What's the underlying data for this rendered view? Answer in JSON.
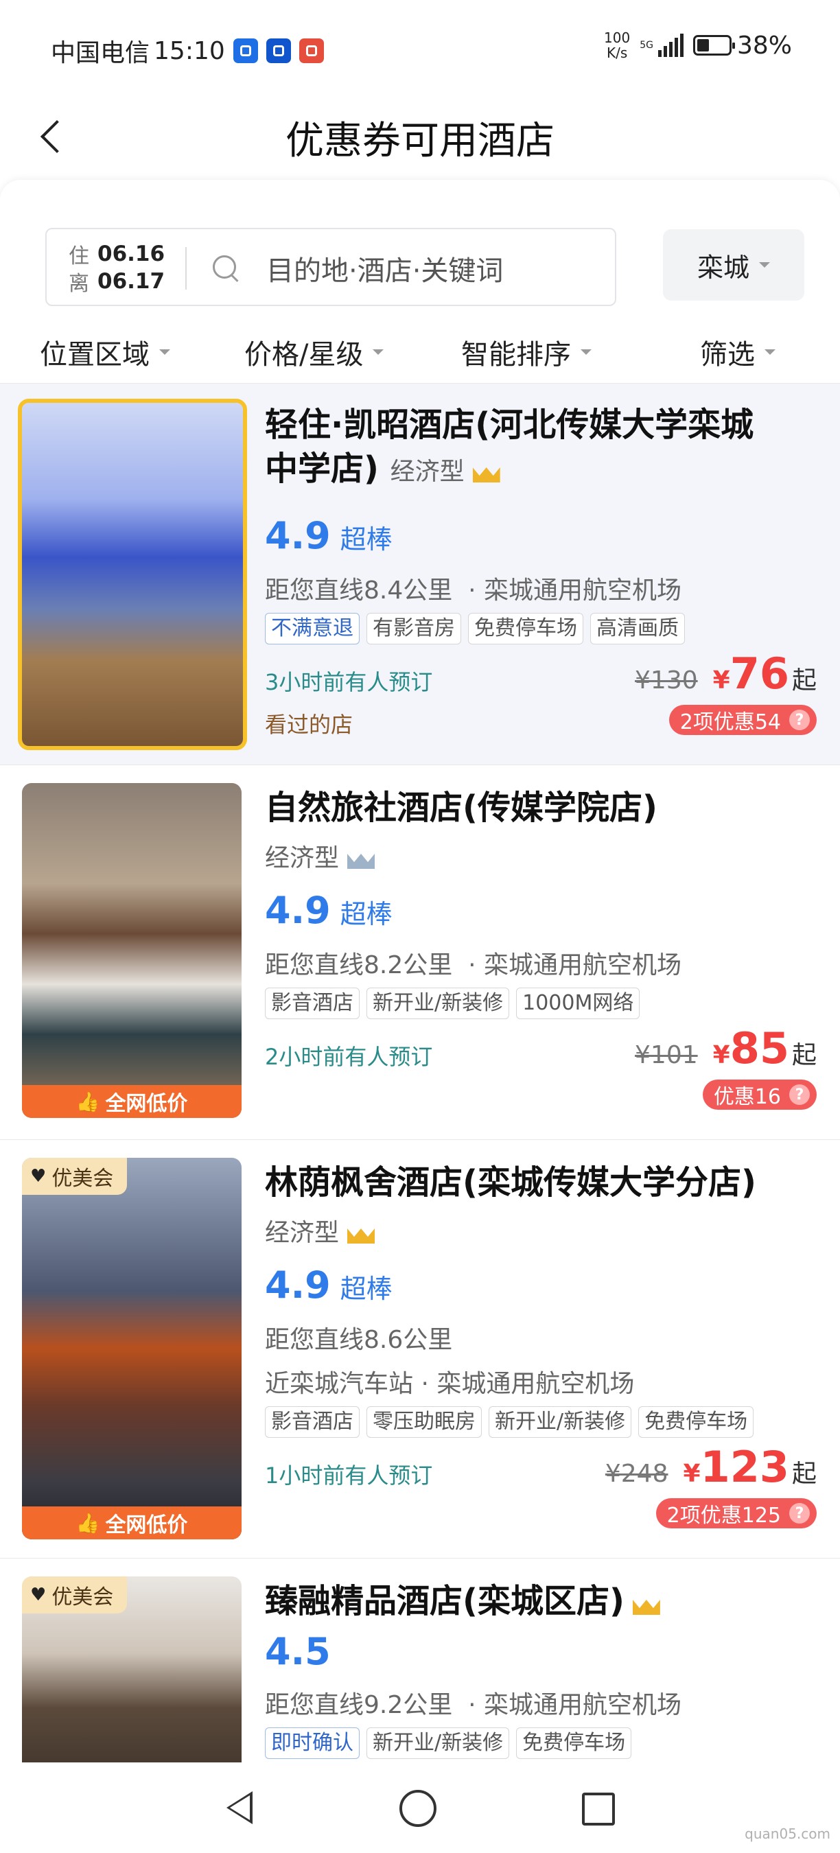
{
  "status_bar": {
    "carrier": "中国电信",
    "time": "15:10",
    "net_speed_value": "100",
    "net_speed_unit": "K/s",
    "network": "5G",
    "battery_percent": "38%",
    "battery_level": 0.38
  },
  "header": {
    "title": "优惠券可用酒店"
  },
  "search": {
    "checkin_label": "住",
    "checkin_date": "06.16",
    "checkout_label": "离",
    "checkout_date": "06.17",
    "placeholder": "目的地·酒店·关键词",
    "city": "栾城"
  },
  "filters": [
    "位置区域",
    "价格/星级",
    "智能排序",
    "筛选"
  ],
  "hotels": [
    {
      "name_line1": "轻住·凯昭酒店(河北传媒大学栾城",
      "name_line2": "中学店)",
      "type": "经济型",
      "score": "4.9",
      "score_word": "超棒",
      "distance": "距您直线8.4公里",
      "landmark": "· 栾城通用航空机场",
      "tags": [
        "不满意退",
        "有影音房",
        "免费停车场",
        "高清画质"
      ],
      "booked": "3小时前有人预订",
      "viewed": "看过的店",
      "orig_price": "¥130",
      "currency": "¥",
      "price": "76",
      "suffix": "起",
      "promo": "2项优惠54",
      "promo_icon": "?"
    },
    {
      "name": "自然旅社酒店(传媒学院店)",
      "type": "经济型",
      "score": "4.9",
      "score_word": "超棒",
      "distance": "距您直线8.2公里",
      "landmark": "· 栾城通用航空机场",
      "tags": [
        "影音酒店",
        "新开业/新装修",
        "1000M网络"
      ],
      "booked": "2小时前有人预订",
      "orig_price": "¥101",
      "currency": "¥",
      "price": "85",
      "suffix": "起",
      "promo": "优惠16",
      "promo_icon": "?",
      "badge": "全网低价"
    },
    {
      "name": "林荫枫舍酒店(栾城传媒大学分店)",
      "type": "经济型",
      "score": "4.9",
      "score_word": "超棒",
      "distance": "距您直线8.6公里",
      "landmark": "近栾城汽车站 · 栾城通用航空机场",
      "tags": [
        "影音酒店",
        "零压助眠房",
        "新开业/新装修",
        "免费停车场"
      ],
      "booked": "1小时前有人预订",
      "orig_price": "¥248",
      "currency": "¥",
      "price": "123",
      "suffix": "起",
      "promo": "2项优惠125",
      "promo_icon": "?",
      "badge": "全网低价",
      "vip": "优美会"
    },
    {
      "name": "臻融精品酒店(栾城区店)",
      "score": "4.5",
      "distance": "距您直线9.2公里",
      "landmark": "· 栾城通用航空机场",
      "tags": [
        "即时确认",
        "新开业/新装修",
        "免费停车场"
      ],
      "vip": "优美会"
    }
  ],
  "thumb_icon": "👍",
  "vip_icon": "♥",
  "watermark": "quan05.com"
}
